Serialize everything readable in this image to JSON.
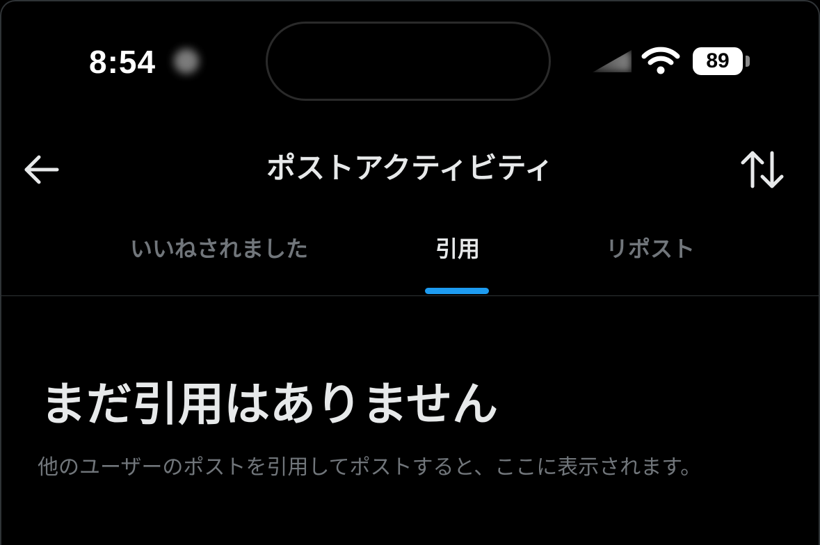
{
  "status_bar": {
    "time": "8:54",
    "battery_level": "89",
    "wifi_icon": "wifi-icon",
    "signal_icon": "cellular-signal-icon"
  },
  "header": {
    "title": "ポストアクティビティ",
    "back_icon": "arrow-left-icon",
    "sort_icon": "sort-arrows-icon"
  },
  "tabs": [
    {
      "label": "いいねされました",
      "active": false
    },
    {
      "label": "引用",
      "active": true
    },
    {
      "label": "リポスト",
      "active": false
    }
  ],
  "empty_state": {
    "title": "まだ引用はありません",
    "description": "他のユーザーのポストを引用してポストすると、ここに表示されます。"
  },
  "colors": {
    "background": "#000000",
    "text_primary": "#e7e9ea",
    "text_secondary": "#71767b",
    "accent": "#1d9bf0",
    "divider": "#2f3336"
  }
}
